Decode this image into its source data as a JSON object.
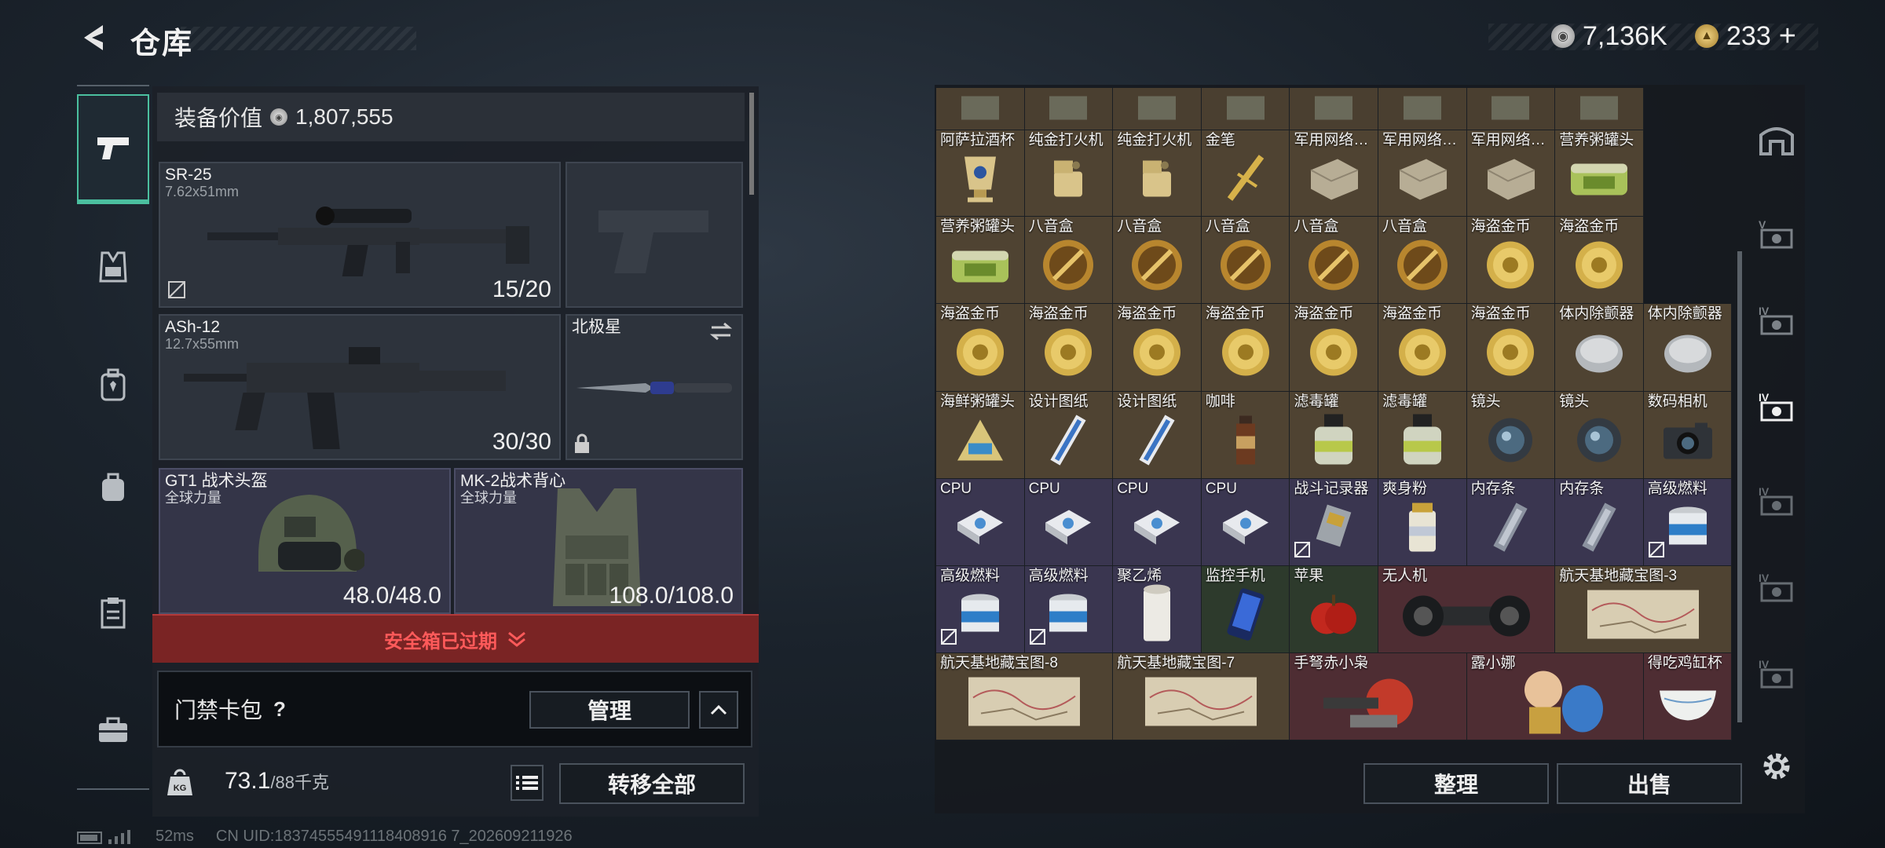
{
  "header": {
    "title": "仓库"
  },
  "currency": {
    "silver": "7,136K",
    "gold": "233",
    "gold_plus": "+"
  },
  "equip_value": {
    "label": "装备价值",
    "value": "1,807,555"
  },
  "weapons": [
    {
      "name": "SR-25",
      "caliber": "7.62x51mm",
      "ammo": "15/20"
    },
    {
      "name": "ASh-12",
      "caliber": "12.7x55mm",
      "ammo": "30/30"
    }
  ],
  "melee": {
    "name": "北极星"
  },
  "armor": [
    {
      "name": "GT1 战术头盔",
      "brand": "全球力量",
      "durability": "48.0/48.0"
    },
    {
      "name": "MK-2战术背心",
      "brand": "全球力量",
      "durability": "108.0/108.0"
    }
  ],
  "safe_box": {
    "status": "安全箱已过期"
  },
  "card_pack": {
    "label": "门禁卡包",
    "help": "?",
    "manage": "管理"
  },
  "weight": {
    "current": "73.1",
    "max": "/88千克"
  },
  "transfer_all": "转移全部",
  "actions": {
    "sort": "整理",
    "sell": "出售"
  },
  "status": {
    "ping": "52ms",
    "uid": "CN UID:18374555491118408916 7_202609211926"
  },
  "colors": {
    "accent": "#4bbf9f",
    "expired": "#ff5a5a",
    "rarity_gold": "#4f4332",
    "rarity_purple": "#3a3650",
    "rarity_red": "#4e2d33",
    "rarity_green": "#2d3a2c"
  },
  "grid_rows": [
    [
      {
        "label": "",
        "icon": "misc"
      },
      {
        "label": "",
        "icon": "misc"
      },
      {
        "label": "",
        "icon": "misc"
      },
      {
        "label": "",
        "icon": "misc"
      },
      {
        "label": "",
        "icon": "misc"
      },
      {
        "label": "",
        "icon": "misc"
      },
      {
        "label": "",
        "icon": "misc"
      },
      {
        "label": "",
        "icon": "misc"
      }
    ],
    [
      {
        "label": "阿萨拉酒杯",
        "icon": "cup"
      },
      {
        "label": "纯金打火机",
        "icon": "lighter"
      },
      {
        "label": "纯金打火机",
        "icon": "lighter"
      },
      {
        "label": "金笔",
        "icon": "pen"
      },
      {
        "label": "军用网络…",
        "icon": "router"
      },
      {
        "label": "军用网络…",
        "icon": "router"
      },
      {
        "label": "军用网络…",
        "icon": "router"
      },
      {
        "label": "营养粥罐头",
        "icon": "can"
      }
    ],
    [
      {
        "label": "营养粥罐头",
        "icon": "can"
      },
      {
        "label": "八音盒",
        "icon": "musicbox"
      },
      {
        "label": "八音盒",
        "icon": "musicbox"
      },
      {
        "label": "八音盒",
        "icon": "musicbox"
      },
      {
        "label": "八音盒",
        "icon": "musicbox"
      },
      {
        "label": "八音盒",
        "icon": "musicbox"
      },
      {
        "label": "海盗金币",
        "icon": "coin"
      },
      {
        "label": "海盗金币",
        "icon": "coin"
      }
    ],
    [
      {
        "label": "海盗金币",
        "icon": "coin"
      },
      {
        "label": "海盗金币",
        "icon": "coin"
      },
      {
        "label": "海盗金币",
        "icon": "coin"
      },
      {
        "label": "海盗金币",
        "icon": "coin"
      },
      {
        "label": "海盗金币",
        "icon": "coin"
      },
      {
        "label": "海盗金币",
        "icon": "coin"
      },
      {
        "label": "海盗金币",
        "icon": "coin"
      },
      {
        "label": "体内除颤器",
        "icon": "defib"
      },
      {
        "label": "体内除颤器",
        "icon": "defib"
      }
    ],
    [
      {
        "label": "海鲜粥罐头",
        "icon": "tincan"
      },
      {
        "label": "设计图纸",
        "icon": "blueprint"
      },
      {
        "label": "设计图纸",
        "icon": "blueprint"
      },
      {
        "label": "咖啡",
        "icon": "coffee"
      },
      {
        "label": "滤毒罐",
        "icon": "filter"
      },
      {
        "label": "滤毒罐",
        "icon": "filter"
      },
      {
        "label": "镜头",
        "icon": "lens"
      },
      {
        "label": "镜头",
        "icon": "lens"
      },
      {
        "label": "数码相机",
        "icon": "camera"
      }
    ],
    [
      {
        "label": "CPU",
        "icon": "cpu"
      },
      {
        "label": "CPU",
        "icon": "cpu"
      },
      {
        "label": "CPU",
        "icon": "cpu"
      },
      {
        "label": "CPU",
        "icon": "cpu"
      },
      {
        "label": "战斗记录器",
        "icon": "recorder"
      },
      {
        "label": "爽身粉",
        "icon": "powder"
      },
      {
        "label": "内存条",
        "icon": "ram"
      },
      {
        "label": "内存条",
        "icon": "ram"
      },
      {
        "label": "高级燃料",
        "icon": "fuel"
      }
    ],
    [
      {
        "label": "高级燃料",
        "icon": "fuel"
      },
      {
        "label": "高级燃料",
        "icon": "fuel"
      },
      {
        "label": "聚乙烯",
        "icon": "roll"
      },
      {
        "label": "监控手机",
        "icon": "phone"
      },
      {
        "label": "苹果",
        "icon": "apple"
      },
      {
        "label": "无人机",
        "icon": "drone"
      },
      {
        "label": "航天基地藏宝图-3",
        "icon": "map"
      }
    ],
    [
      {
        "label": "航天基地藏宝图-8",
        "icon": "map"
      },
      {
        "label": "航天基地藏宝图-7",
        "icon": "map"
      },
      {
        "label": "手弩赤小枭",
        "icon": "crossbow"
      },
      {
        "label": "露小娜",
        "icon": "doll"
      },
      {
        "label": "得吃鸡缸杯",
        "icon": "bowl"
      }
    ]
  ]
}
